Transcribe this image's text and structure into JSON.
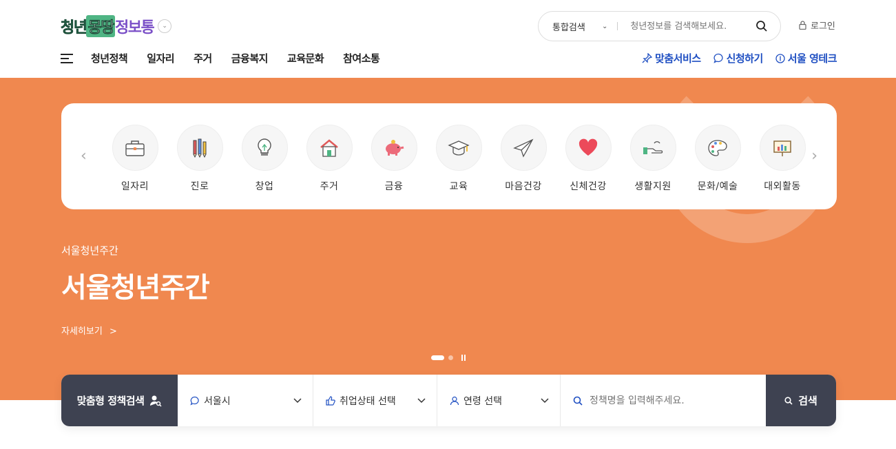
{
  "header": {
    "logo": {
      "part1": "청년",
      "part2": "몽땅",
      "part3": "정보통"
    },
    "search": {
      "type_label": "통합검색",
      "placeholder": "청년정보를 검색해보세요."
    },
    "login_label": "로그인",
    "nav": [
      "청년정책",
      "일자리",
      "주거",
      "금융복지",
      "교육문화",
      "참여소통"
    ],
    "nav_right": [
      "맞춤서비스",
      "신청하기",
      "서울 영테크"
    ]
  },
  "categories": [
    {
      "label": "일자리",
      "icon": "briefcase-icon"
    },
    {
      "label": "진로",
      "icon": "pencils-icon"
    },
    {
      "label": "창업",
      "icon": "lightbulb-icon"
    },
    {
      "label": "주거",
      "icon": "house-icon"
    },
    {
      "label": "금융",
      "icon": "piggy-bank-icon"
    },
    {
      "label": "교육",
      "icon": "graduation-cap-icon"
    },
    {
      "label": "마음건강",
      "icon": "paper-plane-icon"
    },
    {
      "label": "신체건강",
      "icon": "heart-icon"
    },
    {
      "label": "생활지원",
      "icon": "helping-hand-icon"
    },
    {
      "label": "문화/예술",
      "icon": "palette-icon"
    },
    {
      "label": "대외활동",
      "icon": "presentation-board-icon"
    }
  ],
  "hero": {
    "subtitle": "서울청년주간",
    "title": "서울청년주간",
    "more_label": "자세히보기",
    "more_arrow": ">"
  },
  "policy_search": {
    "label": "맞춤형 정책검색",
    "region": "서울시",
    "employment": "취업상태 선택",
    "age": "연령 선택",
    "placeholder": "정책명을 입력해주세요.",
    "button": "검색"
  },
  "colors": {
    "hero_bg": "#f0884f",
    "nav_link": "#1f4fc2",
    "dark_bar": "#3e4251"
  }
}
